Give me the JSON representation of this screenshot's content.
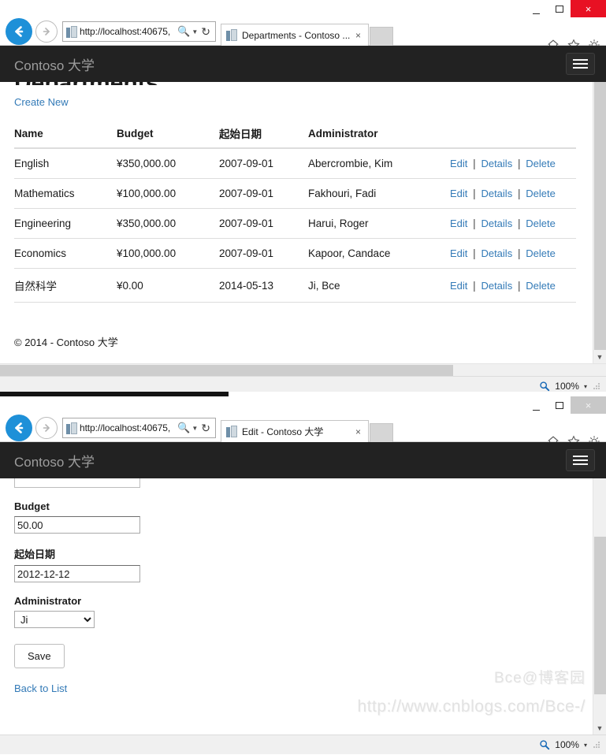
{
  "windows": [
    {
      "id": "departments-window",
      "active": true,
      "controls": {
        "minimize": "—",
        "maximize": "❑",
        "close": "×"
      },
      "address": {
        "url": "http://localhost:40675,",
        "search_icon": "search-icon",
        "dropdown_icon": "chevron-down-icon",
        "refresh_icon": "refresh-icon"
      },
      "tab": {
        "title": "Departments - Contoso ...",
        "close": "×"
      },
      "chrome_icons": [
        "home-icon",
        "favorites-star-icon",
        "settings-gear-icon"
      ],
      "site": {
        "brand": "Contoso 大学",
        "page_title": "Departments",
        "create_new": "Create New",
        "footer": "© 2014 - Contoso 大学"
      },
      "table": {
        "columns": [
          "Name",
          "Budget",
          "起始日期",
          "Administrator",
          ""
        ],
        "actions": {
          "edit": "Edit",
          "details": "Details",
          "delete": "Delete",
          "separator": "|"
        },
        "rows": [
          {
            "name": "English",
            "budget": "¥350,000.00",
            "start_date": "2007-09-01",
            "administrator": "Abercrombie, Kim"
          },
          {
            "name": "Mathematics",
            "budget": "¥100,000.00",
            "start_date": "2007-09-01",
            "administrator": "Fakhouri, Fadi"
          },
          {
            "name": "Engineering",
            "budget": "¥350,000.00",
            "start_date": "2007-09-01",
            "administrator": "Harui, Roger"
          },
          {
            "name": "Economics",
            "budget": "¥100,000.00",
            "start_date": "2007-09-01",
            "administrator": "Kapoor, Candace"
          },
          {
            "name": "自然科学",
            "budget": "¥0.00",
            "start_date": "2014-05-13",
            "administrator": "Ji, Bce"
          }
        ]
      },
      "status": {
        "zoom": "100%",
        "zoom_icon": "zoom-magnifier-icon",
        "caret": "▾"
      }
    },
    {
      "id": "edit-window",
      "active": false,
      "controls": {
        "minimize": "—",
        "maximize": "❑",
        "close": "×"
      },
      "address": {
        "url": "http://localhost:40675,",
        "search_icon": "search-icon",
        "dropdown_icon": "chevron-down-icon",
        "refresh_icon": "refresh-icon"
      },
      "tab": {
        "title": "Edit - Contoso 大学",
        "close": "×"
      },
      "chrome_icons": [
        "home-icon",
        "favorites-star-icon",
        "settings-gear-icon"
      ],
      "site": {
        "brand": "Contoso 大学"
      },
      "form": {
        "clipped_field_value": "",
        "fields": [
          {
            "label": "Budget",
            "value": "50.00",
            "type": "text"
          },
          {
            "label": "起始日期",
            "value": "2012-12-12",
            "type": "text"
          }
        ],
        "administrator": {
          "label": "Administrator",
          "value": "Ji",
          "options": [
            "Ji"
          ]
        },
        "save_label": "Save",
        "back_to_list": "Back to List"
      },
      "status": {
        "zoom": "100%",
        "zoom_icon": "zoom-magnifier-icon",
        "caret": "▾"
      }
    }
  ],
  "watermark": {
    "line1": "Bce@博客园",
    "line2": "http://www.cnblogs.com/Bce-/"
  },
  "colors": {
    "header_dark": "#222222",
    "link_blue": "#337ab7",
    "close_red": "#e81123",
    "back_button_blue": "#1e90d8"
  }
}
